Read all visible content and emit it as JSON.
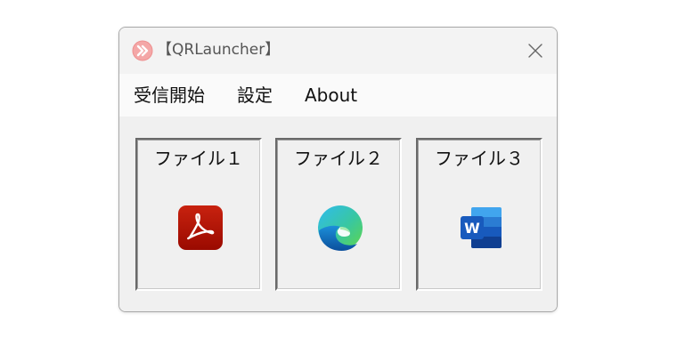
{
  "window": {
    "title": "【QRLauncher】",
    "app_icon": "qrlauncher-app-icon",
    "close_icon": "close-icon"
  },
  "menu": {
    "items": [
      {
        "label": "受信開始"
      },
      {
        "label": "設定"
      },
      {
        "label": "About"
      }
    ]
  },
  "launchers": [
    {
      "label": "ファイル１",
      "icon": "pdf-icon"
    },
    {
      "label": "ファイル２",
      "icon": "edge-browser-icon"
    },
    {
      "label": "ファイル３",
      "icon": "word-icon"
    }
  ],
  "colors": {
    "pdf_red": "#b30b00",
    "word_blue": "#185abd",
    "edge_blue": "#0c59a4",
    "edge_green": "#35c04a",
    "app_icon_pink": "#f4a7a7"
  }
}
